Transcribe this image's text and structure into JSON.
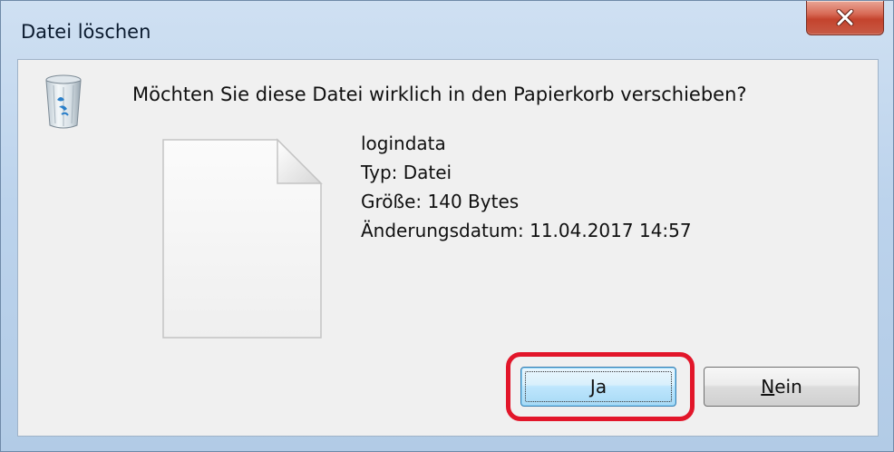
{
  "window": {
    "title": "Datei löschen"
  },
  "dialog": {
    "prompt": "Möchten Sie diese Datei wirklich in den Papierkorb verschieben?",
    "file": {
      "name": "logindata",
      "type_line": "Typ: Datei",
      "size_line": "Größe: 140 Bytes",
      "modified_line": "Änderungsdatum: 11.04.2017 14:57"
    },
    "buttons": {
      "yes_mnemonic": "J",
      "yes_rest": "a",
      "no_mnemonic": "N",
      "no_rest": "ein"
    }
  },
  "icons": {
    "close": "close-icon",
    "recycle_bin": "recycle-bin-icon",
    "file": "blank-file-icon"
  },
  "colors": {
    "highlight": "#e2162a",
    "close_button": "#c4432d",
    "default_button_border": "#3c7fb1"
  }
}
